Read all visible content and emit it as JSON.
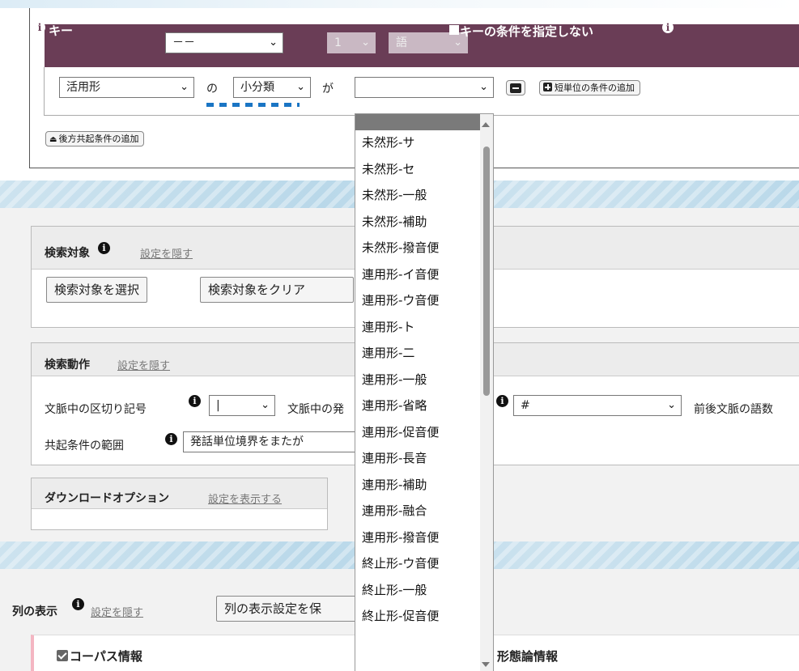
{
  "key": {
    "label": "キー",
    "select_value": "－－",
    "num_value": "1",
    "unit_value": "語",
    "no_condition_label": "キーの条件を指定しない"
  },
  "condition": {
    "field_value": "活用形",
    "particle_no": "の",
    "subfield_value": "小分類",
    "particle_ga": "が",
    "value_value": "",
    "add_short_unit_label": "短単位の条件の追加",
    "add_cooccur_label": "後方共起条件の追加"
  },
  "dropdown": {
    "options": [
      "",
      "未然形-サ",
      "未然形-セ",
      "未然形-一般",
      "未然形-補助",
      "未然形-撥音便",
      "連用形-イ音便",
      "連用形-ウ音便",
      "連用形-ト",
      "連用形-二",
      "連用形-一般",
      "連用形-省略",
      "連用形-促音便",
      "連用形-長音",
      "連用形-補助",
      "連用形-融合",
      "連用形-撥音便",
      "終止形-ウ音便",
      "終止形-一般",
      "終止形-促音便"
    ]
  },
  "search_target": {
    "title": "検索対象",
    "hide_link": "設定を隠す",
    "select_button": "検索対象を選択",
    "clear_button": "検索対象をクリア"
  },
  "search_action": {
    "title": "検索動作",
    "hide_link": "設定を隠す",
    "delimiter_label": "文脈中の区切り記号",
    "delimiter_value": "|",
    "context_label_partial": "文脈中の発",
    "symbol_value": "#",
    "context_count_label_partial": "前後文脈の語数",
    "range_label": "共起条件の範囲",
    "range_value": "発話単位境界をまたが"
  },
  "download": {
    "title": "ダウンロードオプション",
    "show_link": "設定を表示する"
  },
  "columns": {
    "title": "列の表示",
    "hide_link": "設定を隠す",
    "settings_button": "列の表示設定を保",
    "corpus_info": "コーパス情報",
    "morph_info": "形態論情報"
  }
}
